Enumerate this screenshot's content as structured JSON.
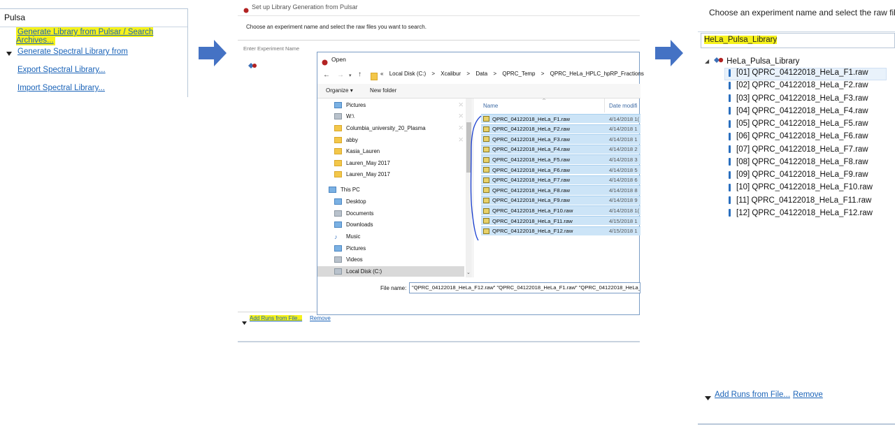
{
  "panel1": {
    "title": "Pulsa",
    "items": [
      {
        "label": "Generate Library from Pulsar / Search Archives..."
      },
      {
        "label": "Generate Spectral Library from"
      },
      {
        "label": "Export Spectral Library..."
      },
      {
        "label": "Import Spectral Library..."
      }
    ]
  },
  "panel2": {
    "window_title": "Set up Library Generation from Pulsar",
    "instruction": "Choose an experiment name and select the raw files you want to search.",
    "experiment_placeholder": "Enter Experiment Name",
    "add_runs_label": "Add Runs from File...",
    "remove_label": "Remove"
  },
  "open_dialog": {
    "title": "Open",
    "breadcrumbs": [
      "«",
      "Local Disk (C:)",
      ">",
      "Xcalibur",
      ">",
      "Data",
      ">",
      "QPRC_Temp",
      ">",
      "QPRC_HeLa_HPLC_hpRP_Fractions"
    ],
    "organize_label": "Organize",
    "new_folder_label": "New folder",
    "nav_items": [
      {
        "label": "Pictures",
        "icon": "pictures-icon"
      },
      {
        "label": "W:\\",
        "icon": "network-drive-icon"
      },
      {
        "label": "Columbia_university_20_Plasma",
        "icon": "folder-icon"
      },
      {
        "label": "abby",
        "icon": "folder-icon"
      },
      {
        "label": "Kasia_Lauren",
        "icon": "folder-icon"
      },
      {
        "label": "Lauren_May 2017",
        "icon": "folder-icon"
      },
      {
        "label": "Lauren_May 2017",
        "icon": "folder-icon"
      },
      {
        "label": "This PC",
        "icon": "computer-icon"
      },
      {
        "label": "Desktop",
        "icon": "desktop-icon"
      },
      {
        "label": "Documents",
        "icon": "documents-icon"
      },
      {
        "label": "Downloads",
        "icon": "downloads-icon"
      },
      {
        "label": "Music",
        "icon": "music-icon"
      },
      {
        "label": "Pictures",
        "icon": "pictures-icon"
      },
      {
        "label": "Videos",
        "icon": "videos-icon"
      },
      {
        "label": "Local Disk (C:)",
        "icon": "disk-icon"
      }
    ],
    "col_name": "Name",
    "col_date": "Date modifi",
    "files": [
      {
        "name": "QPRC_04122018_HeLa_F1.raw",
        "date": "4/14/2018 1("
      },
      {
        "name": "QPRC_04122018_HeLa_F2.raw",
        "date": "4/14/2018 1"
      },
      {
        "name": "QPRC_04122018_HeLa_F3.raw",
        "date": "4/14/2018 1"
      },
      {
        "name": "QPRC_04122018_HeLa_F4.raw",
        "date": "4/14/2018 2"
      },
      {
        "name": "QPRC_04122018_HeLa_F5.raw",
        "date": "4/14/2018 3"
      },
      {
        "name": "QPRC_04122018_HeLa_F6.raw",
        "date": "4/14/2018 5"
      },
      {
        "name": "QPRC_04122018_HeLa_F7.raw",
        "date": "4/14/2018 6"
      },
      {
        "name": "QPRC_04122018_HeLa_F8.raw",
        "date": "4/14/2018 8"
      },
      {
        "name": "QPRC_04122018_HeLa_F9.raw",
        "date": "4/14/2018 9"
      },
      {
        "name": "QPRC_04122018_HeLa_F10.raw",
        "date": "4/14/2018 1("
      },
      {
        "name": "QPRC_04122018_HeLa_F11.raw",
        "date": "4/15/2018 1"
      },
      {
        "name": "QPRC_04122018_HeLa_F12.raw",
        "date": "4/15/2018 1"
      }
    ],
    "filename_label": "File name:",
    "filename_value": "\"QPRC_04122018_HeLa_F12.raw\" \"QPRC_04122018_HeLa_F1.raw\" \"QPRC_04122018_HeLa_"
  },
  "panel3": {
    "instruction": "Choose an experiment name and select the raw files you w",
    "experiment_name": "HeLa_Pulsa_Library",
    "tree_root": "HeLa_Pulsa_Library",
    "runs": [
      "[01]  QPRC_04122018_HeLa_F1.raw",
      "[02]  QPRC_04122018_HeLa_F2.raw",
      "[03]  QPRC_04122018_HeLa_F3.raw",
      "[04]  QPRC_04122018_HeLa_F4.raw",
      "[05]  QPRC_04122018_HeLa_F5.raw",
      "[06]  QPRC_04122018_HeLa_F6.raw",
      "[07]  QPRC_04122018_HeLa_F7.raw",
      "[08]  QPRC_04122018_HeLa_F8.raw",
      "[09]  QPRC_04122018_HeLa_F9.raw",
      "[10]  QPRC_04122018_HeLa_F10.raw",
      "[11]  QPRC_04122018_HeLa_F11.raw",
      "[12]  QPRC_04122018_HeLa_F12.raw"
    ],
    "add_runs_label": "Add Runs from File...",
    "remove_label": "Remove"
  },
  "colors": {
    "highlight": "#f6f21a",
    "link": "#1a63b8",
    "arrow": "#4472c4",
    "selection": "#cce4f7",
    "pen": "#1a3fd0"
  }
}
